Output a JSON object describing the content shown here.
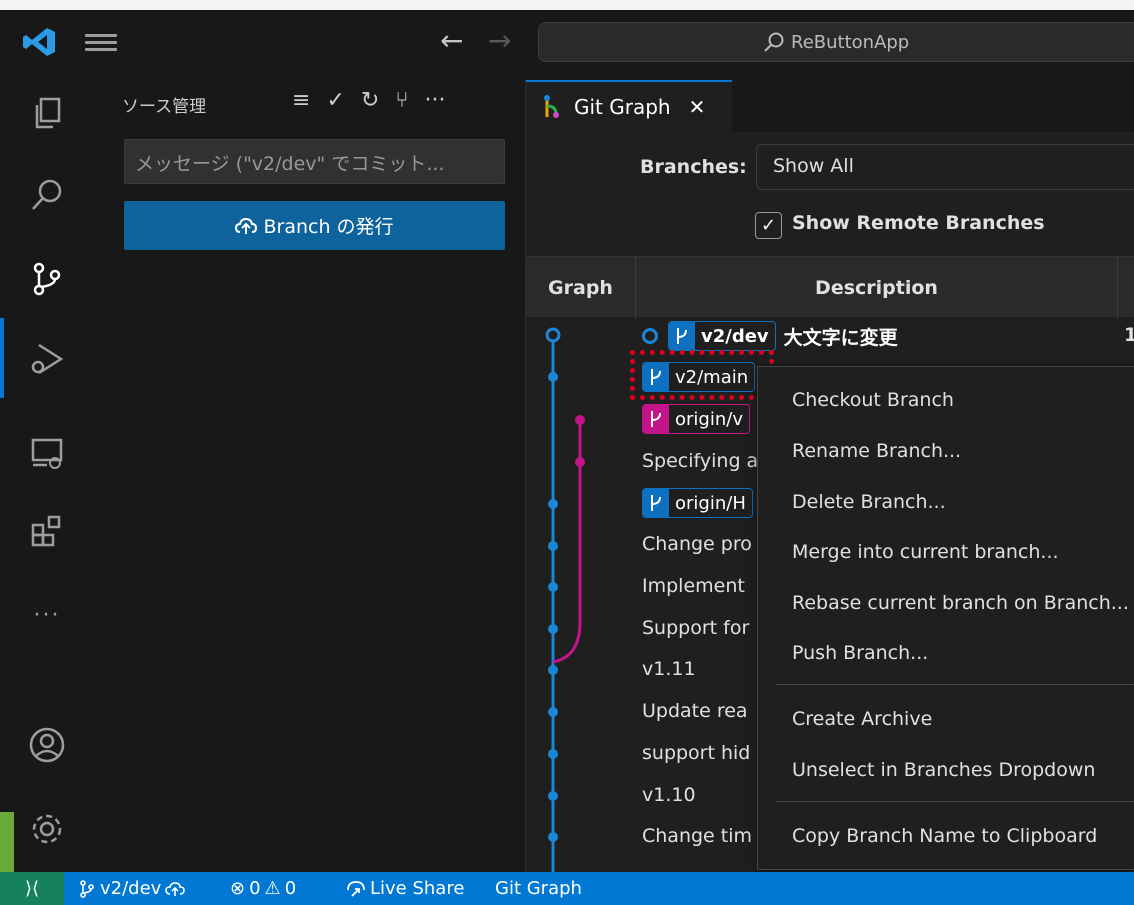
{
  "titlebar": {
    "search_text": "ReButtonApp",
    "back_glyph": "←",
    "forward_glyph": "→"
  },
  "activity": {
    "icons": [
      "explorer-icon",
      "search-icon",
      "source-control-icon",
      "run-debug-icon",
      "remote-explorer-icon",
      "extensions-icon",
      "more-icon",
      "accounts-icon",
      "manage-icon"
    ],
    "more_glyph": "···"
  },
  "sidebar": {
    "title": "ソース管理",
    "commit_placeholder": "メッセージ (\"v2/dev\" でコミット...",
    "publish_label": "Branch の発行"
  },
  "editor": {
    "tab_label": "Git Graph",
    "tab_close": "✕",
    "branches_label": "Branches:",
    "branches_value": "Show All",
    "remote_label": "Show Remote Branches",
    "remote_checked": "✓",
    "col_graph": "Graph",
    "col_desc": "Description",
    "col_extra": "1",
    "rows": [
      {
        "ref": "v2/dev",
        "message": "大文字に変更"
      },
      {
        "ref": "v2/main",
        "message": ""
      },
      {
        "ref": "origin/v",
        "message": ""
      },
      {
        "ref": "",
        "message": "Specifying a"
      },
      {
        "ref": "origin/H",
        "message": ""
      },
      {
        "ref": "",
        "message": "Change pro"
      },
      {
        "ref": "",
        "message": "Implement"
      },
      {
        "ref": "",
        "message": "Support for"
      },
      {
        "ref": "",
        "message": "v1.11"
      },
      {
        "ref": "",
        "message": "Update rea"
      },
      {
        "ref": "",
        "message": "support hid"
      },
      {
        "ref": "",
        "message": "v1.10"
      },
      {
        "ref": "",
        "message": "Change tim"
      }
    ]
  },
  "context_menu": {
    "items": [
      "Checkout Branch",
      "Rename Branch...",
      "Delete Branch...",
      "Merge into current branch...",
      "Rebase current branch on Branch...",
      "Push Branch...",
      "Create Archive",
      "Unselect in Branches Dropdown",
      "Copy Branch Name to Clipboard"
    ]
  },
  "statusbar": {
    "remote_glyph": "⟩⟨",
    "branch": "v2/dev",
    "errors": "0",
    "warnings": "0",
    "live_share": "Live Share",
    "git_graph": "Git Graph"
  },
  "colors": {
    "accent": "#0078d4",
    "graph_blue": "#1a86d8",
    "graph_magenta": "#c4148a",
    "highlight_red": "#e0001b"
  }
}
